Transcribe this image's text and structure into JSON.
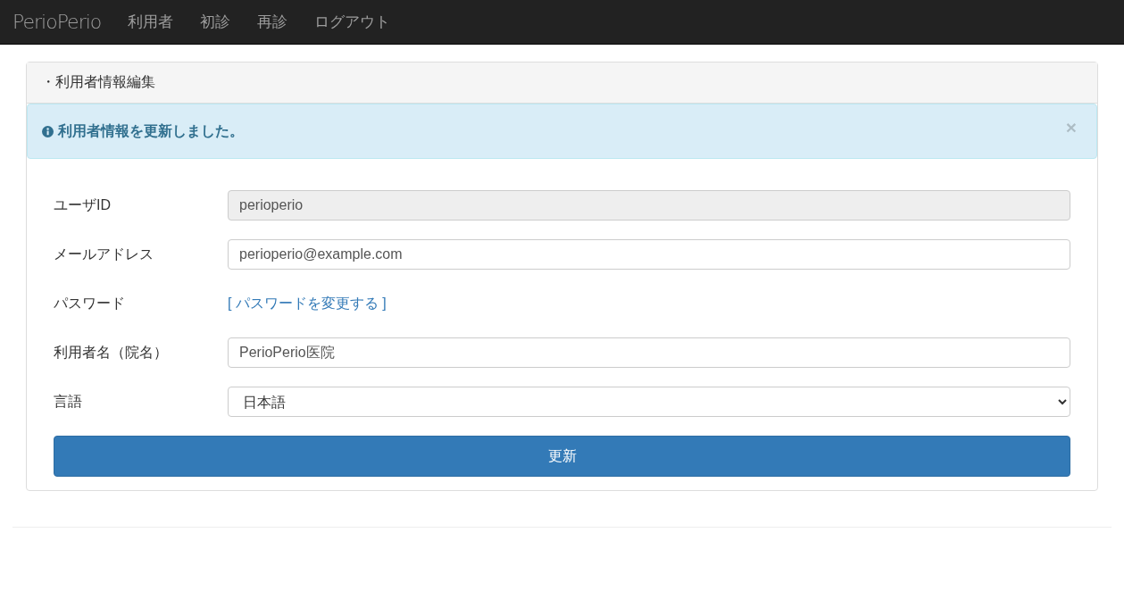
{
  "navbar": {
    "brand": "PerioPerio",
    "items": [
      "利用者",
      "初診",
      "再診",
      "ログアウト"
    ]
  },
  "panel": {
    "heading": "・利用者情報編集",
    "alert": {
      "message": "利用者情報を更新しました。",
      "close": "×"
    },
    "fields": [
      {
        "kind": "input",
        "label": "ユーザID",
        "value": "perioperio",
        "disabled": true
      },
      {
        "kind": "input",
        "label": "メールアドレス",
        "value": "perioperio@example.com",
        "disabled": false
      },
      {
        "kind": "link",
        "label": "パスワード",
        "value": "[ パスワードを変更する ]"
      },
      {
        "kind": "input",
        "label": "利用者名（院名）",
        "value": "PerioPerio医院",
        "disabled": false
      },
      {
        "kind": "select",
        "label": "言語",
        "value": "日本語"
      }
    ],
    "submit": "更新"
  }
}
